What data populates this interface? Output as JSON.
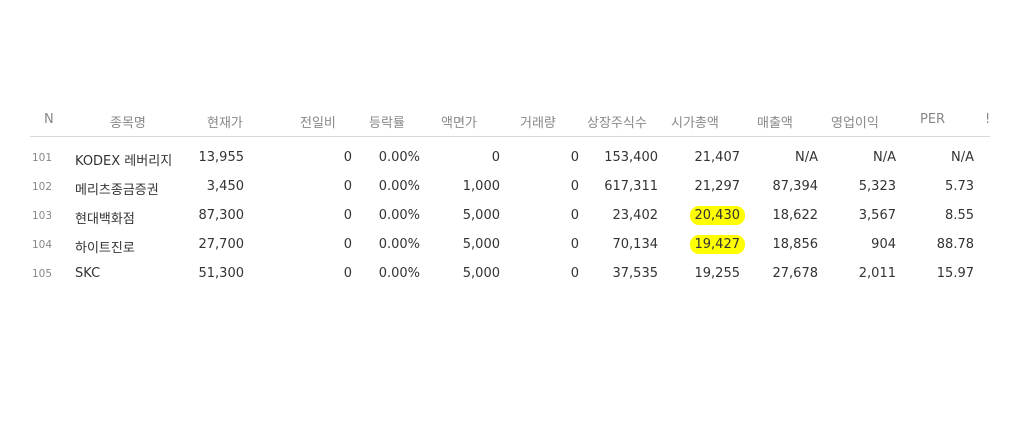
{
  "table": {
    "headers": [
      "N",
      "종목명",
      "현재가",
      "전일비",
      "등락률",
      "액면가",
      "거래량",
      "상장주식수",
      "시가총액",
      "매출액",
      "영업이익",
      "PER",
      "!"
    ],
    "rows": [
      [
        "101",
        "KODEX 레버리지",
        "13,955",
        "0",
        "0.00%",
        "0",
        "0",
        "153,400",
        "21,407",
        "N/A",
        "N/A",
        "N/A"
      ],
      [
        "102",
        "메리츠종금증권",
        "3,450",
        "0",
        "0.00%",
        "1,000",
        "0",
        "617,311",
        "21,297",
        "87,394",
        "5,323",
        "5.73"
      ],
      [
        "103",
        "현대백화점",
        "87,300",
        "0",
        "0.00%",
        "5,000",
        "0",
        "23,402",
        "20,430",
        "18,622",
        "3,567",
        "8.55"
      ],
      [
        "104",
        "하이트진로",
        "27,700",
        "0",
        "0.00%",
        "5,000",
        "0",
        "70,134",
        "19,427",
        "18,856",
        "904",
        "88.78"
      ],
      [
        "105",
        "SKC",
        "51,300",
        "0",
        "0.00%",
        "5,000",
        "0",
        "37,535",
        "19,255",
        "27,678",
        "2,011",
        "15.97"
      ]
    ]
  },
  "highlight_color": "#ffff00"
}
